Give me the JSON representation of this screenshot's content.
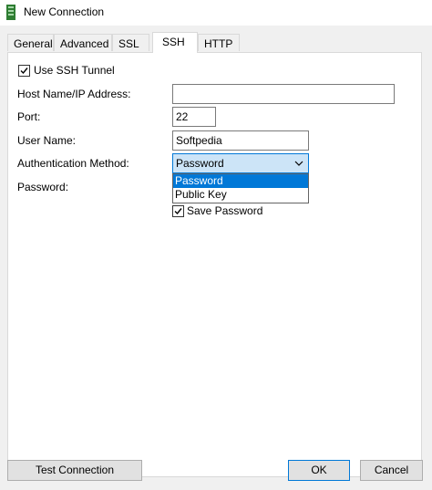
{
  "window": {
    "title": "New Connection"
  },
  "tabs": [
    {
      "label": "General",
      "active": false
    },
    {
      "label": "Advanced",
      "active": false
    },
    {
      "label": "SSL",
      "active": false
    },
    {
      "label": "SSH",
      "active": true
    },
    {
      "label": "HTTP",
      "active": false
    }
  ],
  "ssh": {
    "use_tunnel_label": "Use SSH Tunnel",
    "use_tunnel_checked": true,
    "host_label": "Host Name/IP Address:",
    "host_value": "",
    "port_label": "Port:",
    "port_value": "22",
    "user_label": "User Name:",
    "user_value": "Softpedia",
    "auth_label": "Authentication Method:",
    "auth_selected": "Password",
    "auth_options": [
      "Password",
      "Public Key"
    ],
    "password_label": "Password:",
    "save_password_label": "Save Password",
    "save_password_checked": true
  },
  "buttons": {
    "test": "Test Connection",
    "ok": "OK",
    "cancel": "Cancel"
  },
  "colors": {
    "accent": "#0078d7",
    "selected_field": "#cce4f7"
  }
}
